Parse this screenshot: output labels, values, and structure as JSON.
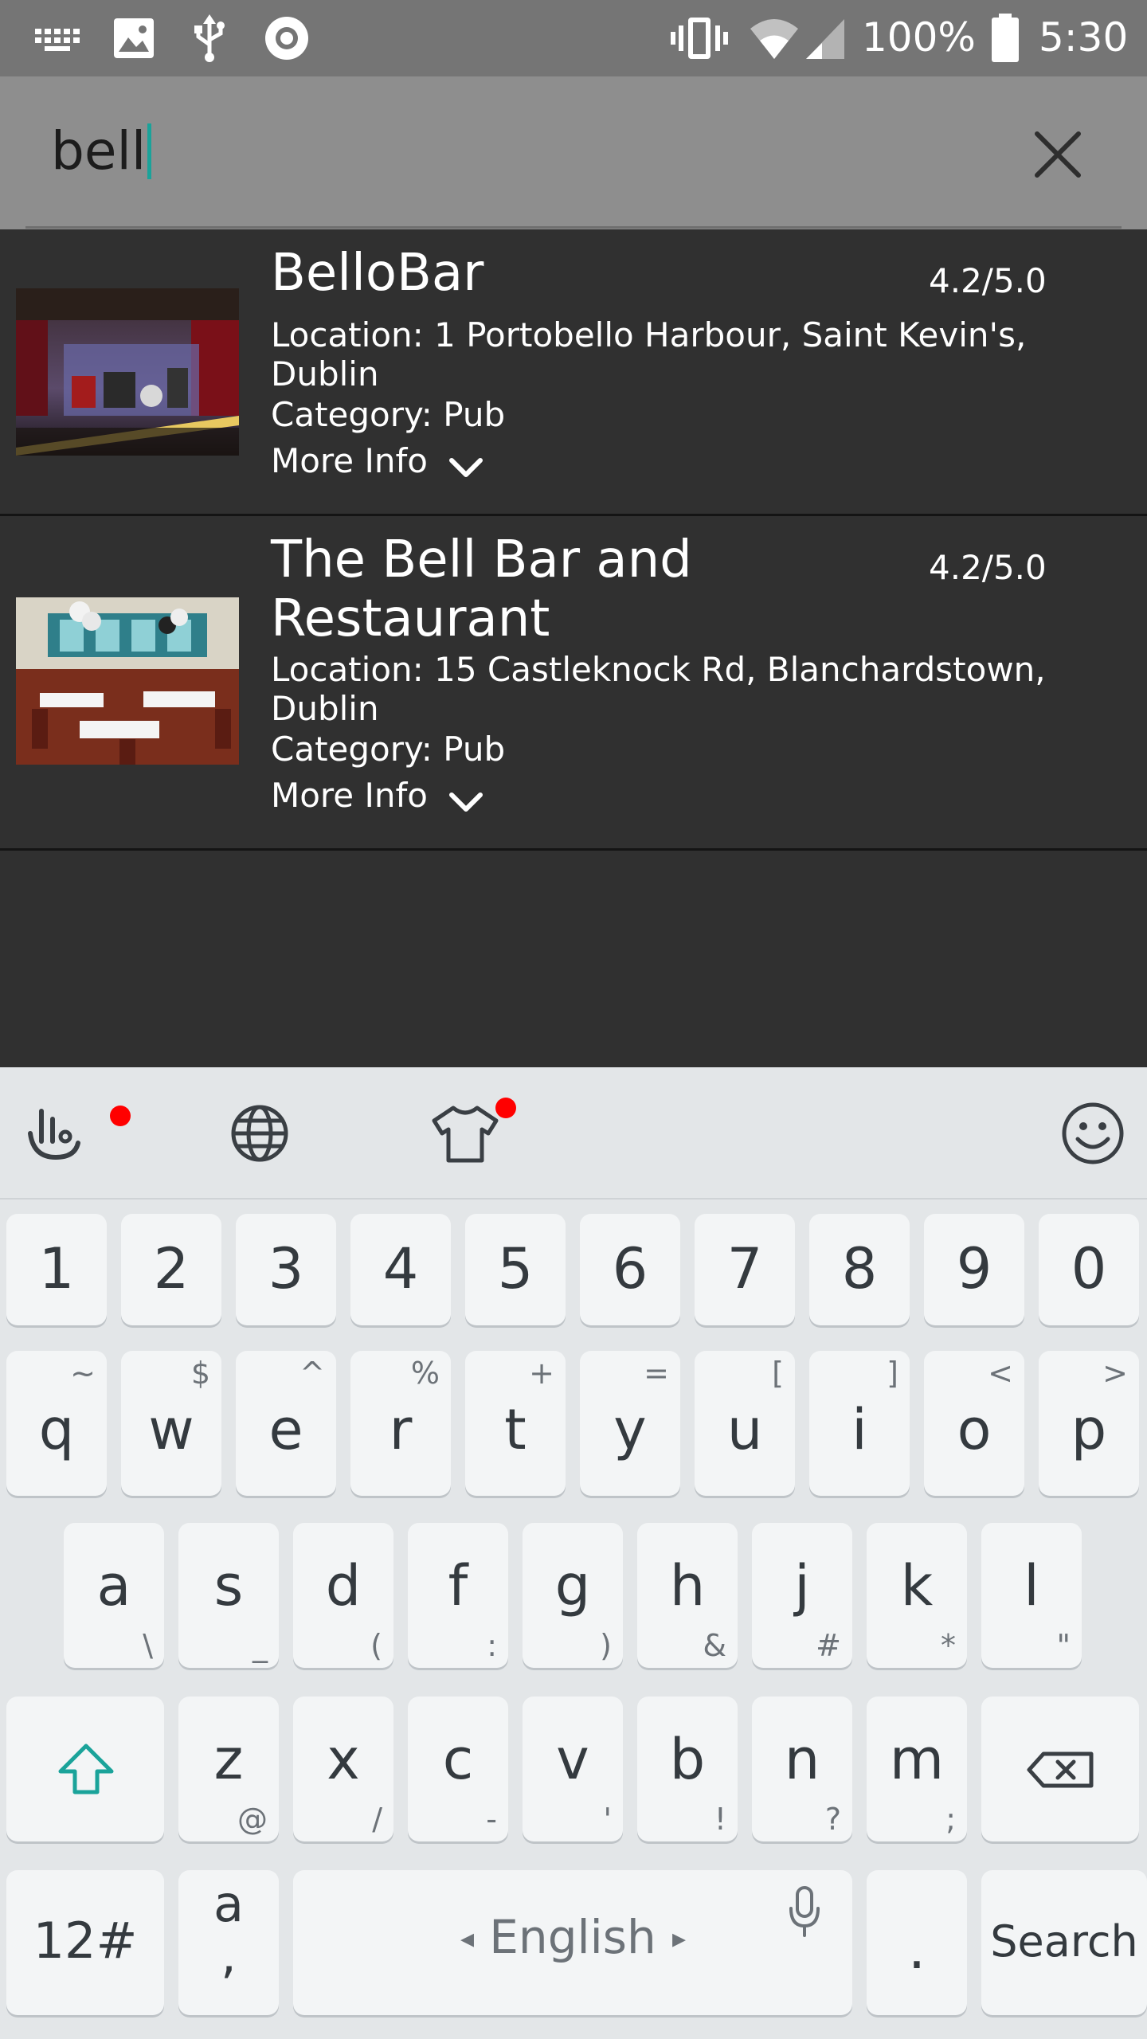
{
  "status_bar": {
    "icons": [
      "keyboard-icon",
      "image-icon",
      "usb-icon",
      "record-icon",
      "vibrate-icon",
      "wifi-icon",
      "signal-icon",
      "battery-icon"
    ],
    "battery_text": "100%",
    "time": "5:30"
  },
  "search": {
    "query": "bell",
    "clear_icon": "close-icon"
  },
  "results": [
    {
      "name": "BelloBar",
      "rating": "4.2/5.0",
      "location": "Location: 1 Portobello Harbour, Saint Kevin's, Dublin",
      "category": "Category: Pub",
      "more_info": "More Info",
      "image": "bar-stage-photo"
    },
    {
      "name": "The Bell Bar and Restaurant",
      "rating": "4.2/5.0",
      "location": "Location: 15 Castleknock Rd, Blanchardstown, Dublin",
      "category": "Category: Pub",
      "more_info": "More Info",
      "image": "restaurant-dining-photo"
    }
  ],
  "keyboard": {
    "toolbar_icons": [
      "touchpal-icon",
      "globe-icon",
      "theme-shirt-icon",
      "emoji-icon"
    ],
    "accent_color": "#1aa39a",
    "notification_color": "#ff0000",
    "number_row": [
      "1",
      "2",
      "3",
      "4",
      "5",
      "6",
      "7",
      "8",
      "9",
      "0"
    ],
    "row1": [
      {
        "key": "q",
        "hint": "~"
      },
      {
        "key": "w",
        "hint": "$"
      },
      {
        "key": "e",
        "hint": "^"
      },
      {
        "key": "r",
        "hint": "%"
      },
      {
        "key": "t",
        "hint": "+"
      },
      {
        "key": "y",
        "hint": "="
      },
      {
        "key": "u",
        "hint": "["
      },
      {
        "key": "i",
        "hint": "]"
      },
      {
        "key": "o",
        "hint": "<"
      },
      {
        "key": "p",
        "hint": ">"
      }
    ],
    "row2": [
      {
        "key": "a",
        "hint": "\\"
      },
      {
        "key": "s",
        "hint": "_"
      },
      {
        "key": "d",
        "hint": "("
      },
      {
        "key": "f",
        "hint": ":"
      },
      {
        "key": "g",
        "hint": ")"
      },
      {
        "key": "h",
        "hint": "&"
      },
      {
        "key": "j",
        "hint": "#"
      },
      {
        "key": "k",
        "hint": "*"
      },
      {
        "key": "l",
        "hint": "\""
      }
    ],
    "row3": [
      {
        "key": "z",
        "hint": "@"
      },
      {
        "key": "x",
        "hint": "/"
      },
      {
        "key": "c",
        "hint": "-"
      },
      {
        "key": "v",
        "hint": "'"
      },
      {
        "key": "b",
        "hint": "!"
      },
      {
        "key": "n",
        "hint": "?"
      },
      {
        "key": "m",
        "hint": ";"
      }
    ],
    "shift_icon": "shift-arrow-icon",
    "backspace_icon": "backspace-icon",
    "symbols_label": "12#",
    "punct_top": "a",
    "punct_bottom": ",",
    "space_label": "English",
    "mic_icon": "microphone-icon",
    "period_label": ".",
    "action_label": "Search"
  }
}
